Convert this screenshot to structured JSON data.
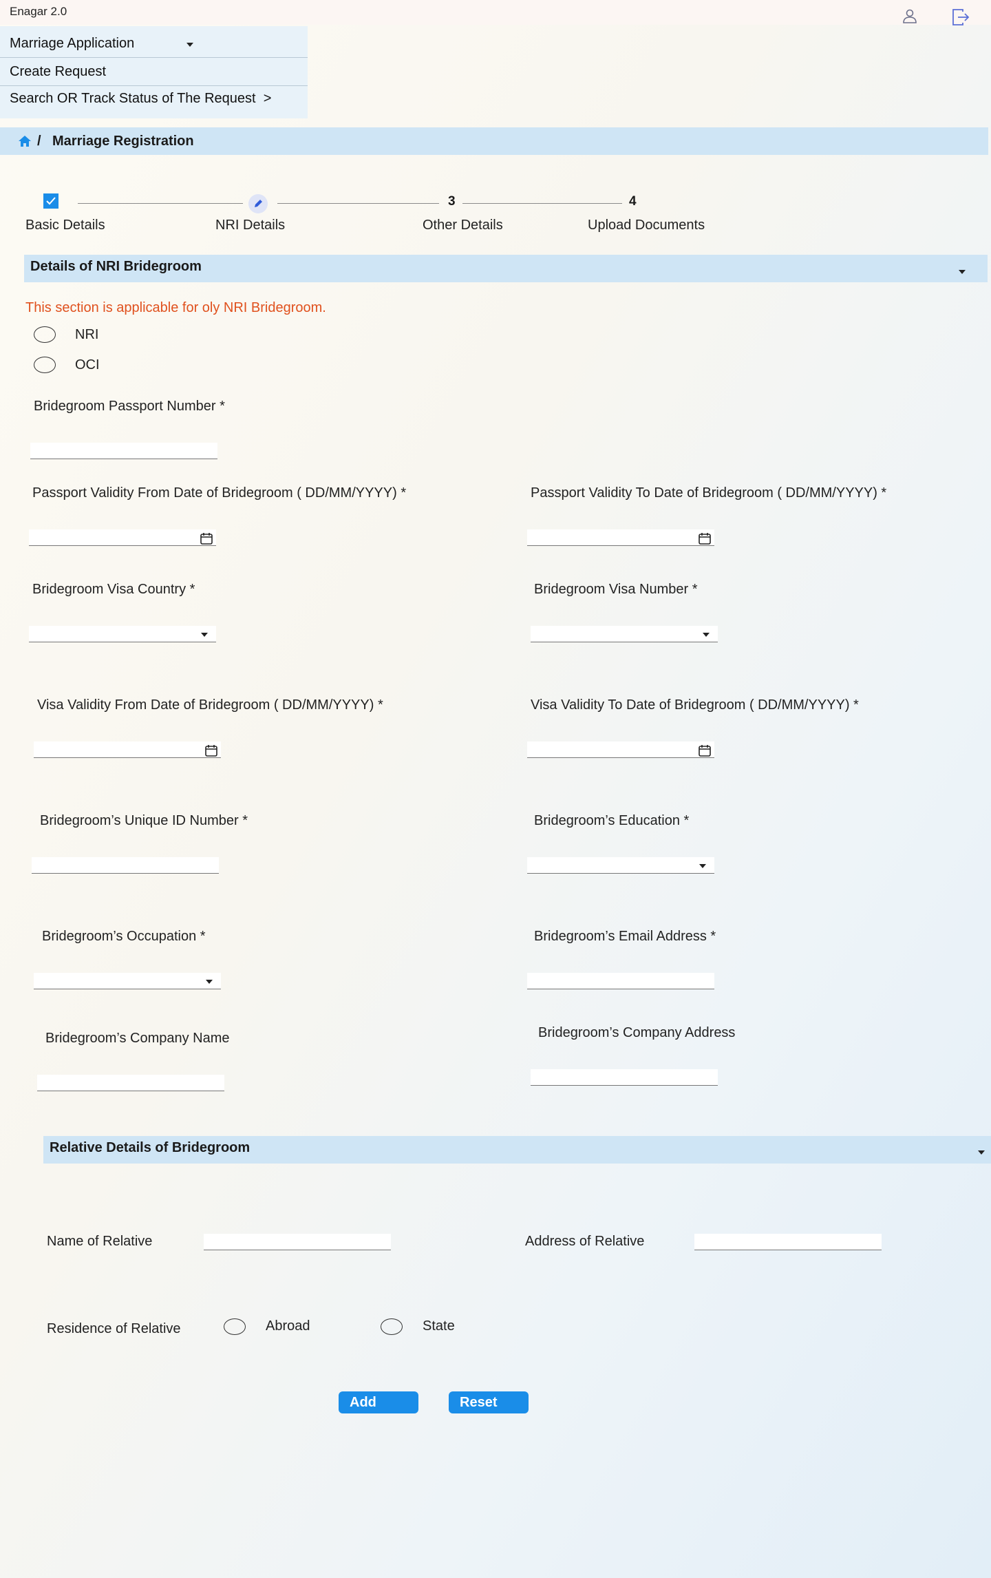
{
  "header": {
    "app_title": "Enagar 2.0",
    "user_icon": "user-icon",
    "logout_icon": "logout-icon"
  },
  "menu": {
    "items": [
      {
        "label": "Marriage Application",
        "icon": "chevron-down-icon"
      },
      {
        "label": "Create Request"
      },
      {
        "label": "Search OR Track Status of The Request",
        "suffix": ">"
      }
    ]
  },
  "breadcrumb": {
    "home_icon": "home-icon",
    "separator": "/",
    "current": "Marriage Registration"
  },
  "stepper": {
    "steps": [
      {
        "label": "Basic Details",
        "state": "done",
        "marker": "check-icon"
      },
      {
        "label": "NRI Details",
        "state": "active",
        "marker": "pencil-icon"
      },
      {
        "label": "Other Details",
        "state": "pending",
        "marker": "3"
      },
      {
        "label": "Upload Documents",
        "state": "pending",
        "marker": "4"
      }
    ]
  },
  "nri_section": {
    "title": "Details of NRI Bridegroom",
    "notice": "This section is applicable for oly NRI Bridegroom.",
    "radio_nri": "NRI",
    "radio_oci": "OCI",
    "passport_number": "Bridegroom Passport Number *",
    "passport_from": "Passport Validity From Date of Bridegroom ( DD/MM/YYYY) *",
    "passport_to": "Passport Validity To Date of Bridegroom ( DD/MM/YYYY) *",
    "visa_country": "Bridegroom Visa Country *",
    "visa_number": "Bridegroom Visa Number *",
    "visa_from": "Visa Validity From Date of Bridegroom ( DD/MM/YYYY) *",
    "visa_to": "Visa Validity To Date of Bridegroom ( DD/MM/YYYY) *",
    "unique_id": "Bridegroom’s Unique ID Number *",
    "education": "Bridegroom’s Education *",
    "occupation": "Bridegroom’s Occupation *",
    "email": "Bridegroom’s Email Address *",
    "company_name": "Bridegroom’s Company Name",
    "company_address": "Bridegroom’s Company Address"
  },
  "relative_section": {
    "title": "Relative Details of Bridegroom",
    "name": "Name of Relative",
    "address": "Address of Relative",
    "residence": "Residence of Relative",
    "radio_abroad": "Abroad",
    "radio_state": "State"
  },
  "buttons": {
    "add": "Add",
    "reset": "Reset"
  },
  "colors": {
    "accent": "#1a8de8",
    "section_bg": "#cfe5f5",
    "notice": "#e0511e"
  }
}
